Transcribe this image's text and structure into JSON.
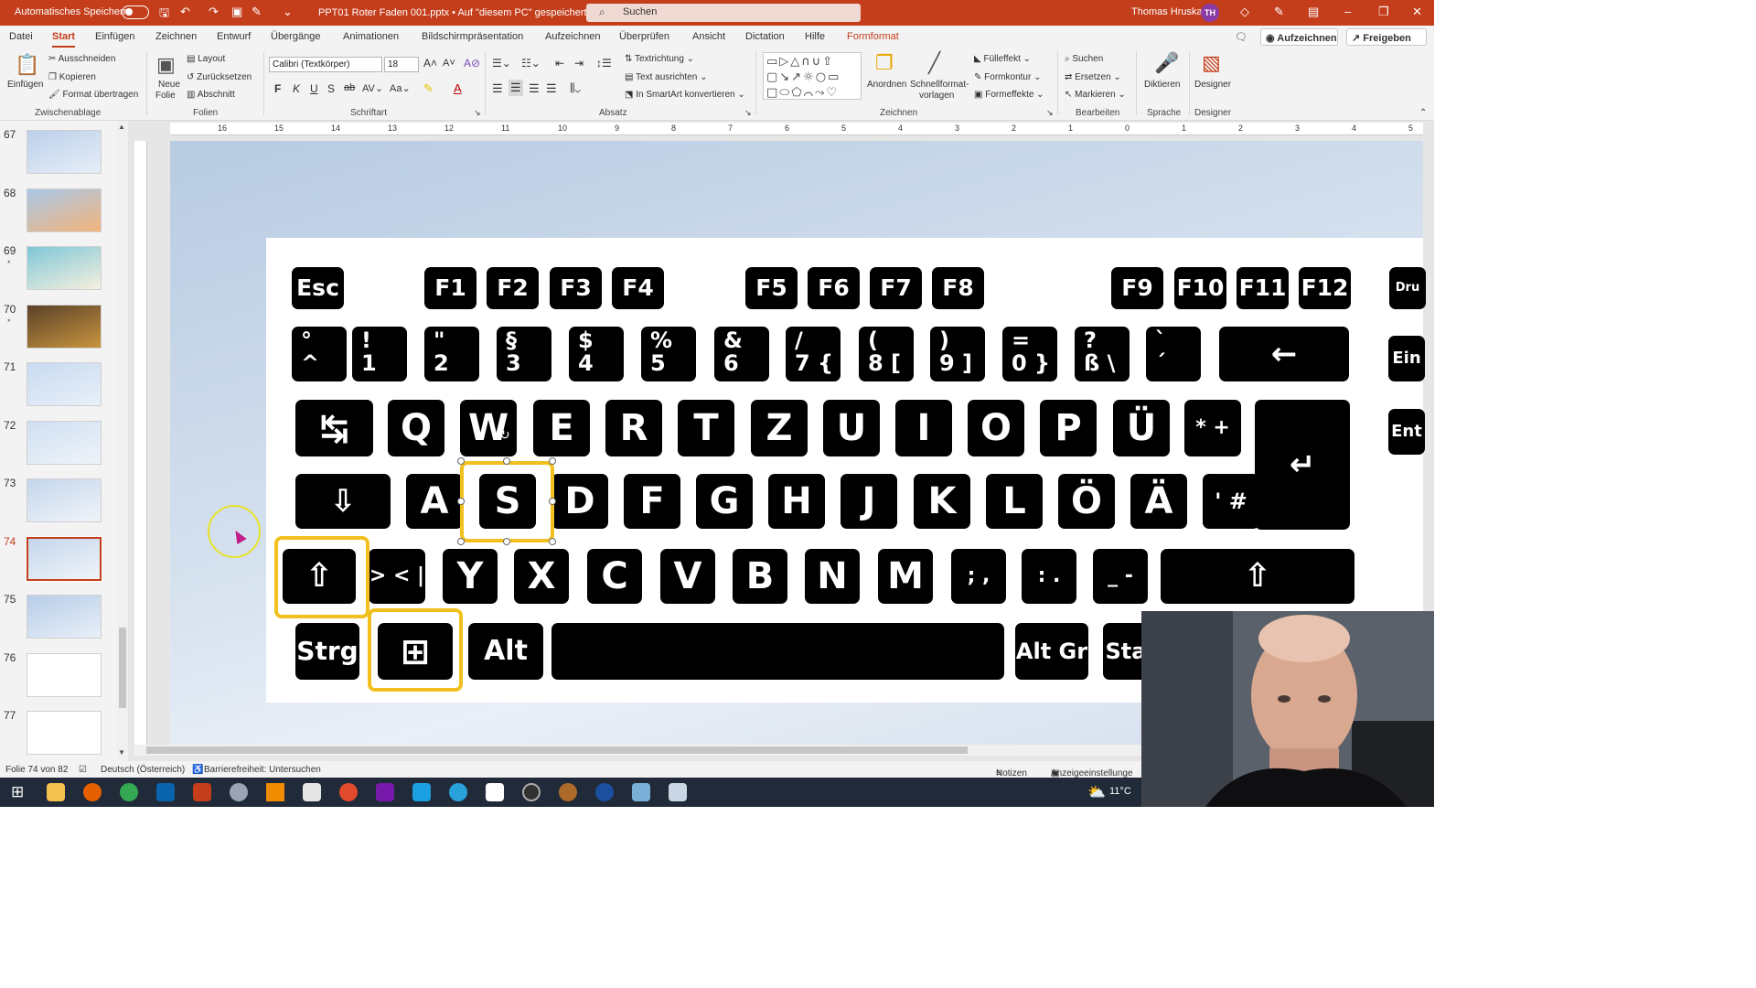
{
  "titlebar": {
    "autosave_label": "Automatisches Speichern",
    "filename": "PPT01 Roter Faden 001.pptx  •  Auf \"diesem PC\" gespeichert ⌄",
    "search_placeholder": "Suchen",
    "user_name": "Thomas Hruska",
    "user_initials": "TH"
  },
  "menu": {
    "tabs": [
      "Datei",
      "Start",
      "Einfügen",
      "Zeichnen",
      "Entwurf",
      "Übergänge",
      "Animationen",
      "Bildschirmpräsentation",
      "Aufzeichnen",
      "Überprüfen",
      "Ansicht",
      "Dictation",
      "Hilfe",
      "Formformat"
    ],
    "active_tab": "Start",
    "record_label": "Aufzeichnen",
    "share_label": "Freigeben"
  },
  "ribbon": {
    "clipboard": {
      "paste": "Einfügen",
      "cut": "Ausschneiden",
      "copy": "Kopieren",
      "format_painter": "Format übertragen",
      "group": "Zwischenablage"
    },
    "slides": {
      "new_slide_1": "Neue",
      "new_slide_2": "Folie",
      "layout": "Layout",
      "reset": "Zurücksetzen",
      "section": "Abschnitt",
      "group": "Folien"
    },
    "font": {
      "family": "Calibri (Textkörper)",
      "size": "18",
      "bold": "F",
      "italic": "K",
      "underline": "U",
      "strike": "S",
      "group": "Schriftart"
    },
    "paragraph": {
      "text_direction": "Textrichtung",
      "align_text": "Text ausrichten",
      "smartart": "In SmartArt konvertieren",
      "group": "Absatz"
    },
    "drawing": {
      "arrange": "Anordnen",
      "quick_styles_1": "Schnellformat-",
      "quick_styles_2": "vorlagen",
      "fill": "Fülleffekt",
      "outline": "Formkontur",
      "effects": "Formeffekte",
      "group": "Zeichnen"
    },
    "editing": {
      "find": "Suchen",
      "replace": "Ersetzen",
      "select": "Markieren",
      "group": "Bearbeiten"
    },
    "voice": {
      "dictate": "Diktieren",
      "group": "Sprache"
    },
    "designer": {
      "label": "Designer",
      "group": "Designer"
    }
  },
  "thumbnails": [
    {
      "num": "67",
      "star": false,
      "colors": [
        "#bcd0ea",
        "#e6eef8"
      ]
    },
    {
      "num": "68",
      "star": false,
      "colors": [
        "#a9c8e8",
        "#f2b37a"
      ]
    },
    {
      "num": "69",
      "star": true,
      "colors": [
        "#7fc7d8",
        "#f6f0de"
      ]
    },
    {
      "num": "70",
      "star": true,
      "colors": [
        "#5a4128",
        "#c9953f"
      ]
    },
    {
      "num": "71",
      "star": false,
      "colors": [
        "#c8daf0",
        "#e8f0f9"
      ]
    },
    {
      "num": "72",
      "star": false,
      "colors": [
        "#d0e0f2",
        "#eef3f9"
      ]
    },
    {
      "num": "73",
      "star": false,
      "colors": [
        "#c4d6ec",
        "#f0f4f9"
      ]
    },
    {
      "num": "74",
      "star": false,
      "colors": [
        "#c4d6ec",
        "#f0f4f9"
      ]
    },
    {
      "num": "75",
      "star": false,
      "colors": [
        "#b7cde8",
        "#e8eff8"
      ]
    },
    {
      "num": "76",
      "star": false,
      "colors": [
        "#ffffff",
        "#ffffff"
      ]
    },
    {
      "num": "77",
      "star": false,
      "colors": [
        "#ffffff",
        "#ffffff"
      ]
    }
  ],
  "selected_thumb": "74",
  "ruler": {
    "h": [
      "16",
      "15",
      "14",
      "13",
      "12",
      "11",
      "10",
      "9",
      "8",
      "7",
      "6",
      "5",
      "4",
      "3",
      "2",
      "1",
      "0",
      "1",
      "2",
      "3",
      "4",
      "5"
    ]
  },
  "keyboard": {
    "row_fn": [
      "Esc",
      "F1",
      "F2",
      "F3",
      "F4",
      "F5",
      "F6",
      "F7",
      "F8",
      "F9",
      "F10",
      "F11",
      "F12",
      "Dru S-A"
    ],
    "row_num": [
      [
        "°",
        "^"
      ],
      [
        "!",
        "1"
      ],
      [
        "\"",
        "2"
      ],
      [
        "§",
        "3"
      ],
      [
        "$",
        "4"
      ],
      [
        "%",
        "5"
      ],
      [
        "&",
        "6"
      ],
      [
        "/",
        "7 {"
      ],
      [
        "(",
        "8 ["
      ],
      [
        ")",
        "9 ]"
      ],
      [
        "=",
        "0 }"
      ],
      [
        "?",
        "ß \\"
      ],
      [
        "`",
        "´"
      ],
      [
        "←",
        ""
      ],
      [
        "Ein",
        ""
      ]
    ],
    "row_q": [
      "↹",
      "Q",
      "W",
      "E",
      "R",
      "T",
      "Z",
      "U",
      "I",
      "O",
      "P",
      "Ü",
      "* + ~",
      "↵",
      "Ent"
    ],
    "row_a": [
      "⇩",
      "A",
      "S",
      "D",
      "F",
      "G",
      "H",
      "J",
      "K",
      "L",
      "Ö",
      "Ä",
      "' #"
    ],
    "row_y": [
      "⇧",
      "> <  |",
      "Y",
      "X",
      "C",
      "V",
      "B",
      "N",
      "M",
      "; ,",
      ": .",
      "_ -",
      "⇧"
    ],
    "row_ctrl": [
      "Strg",
      "⊞",
      "Alt",
      "",
      "Alt Gr",
      "Sta"
    ]
  },
  "status": {
    "slide_info": "Folie 74 von 82",
    "language": "Deutsch (Österreich)",
    "accessibility": "Barrierefreiheit: Untersuchen",
    "notes": "Notizen",
    "display": "Anzeigeeinstellunge"
  },
  "taskbar": {
    "weather": "11°C"
  }
}
